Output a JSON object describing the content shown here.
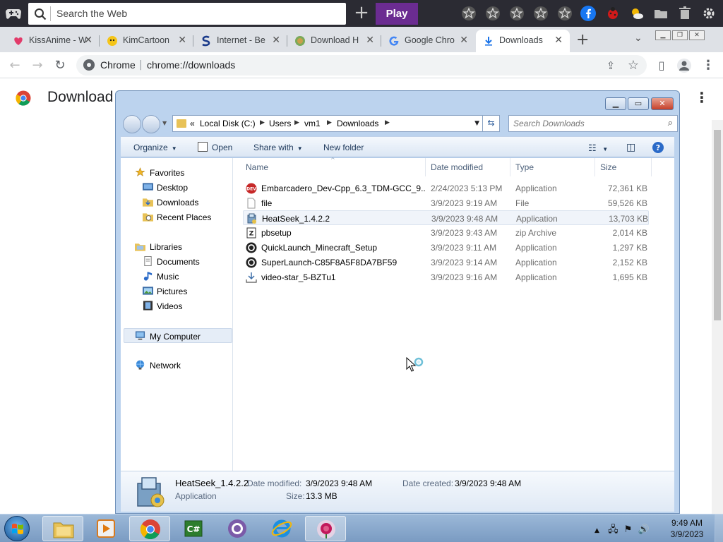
{
  "toolbar": {
    "search_placeholder": "Search the Web",
    "play_label": "Play"
  },
  "tabs": [
    {
      "title": "KissAnime - W"
    },
    {
      "title": "KimCartoon"
    },
    {
      "title": "Internet - Be"
    },
    {
      "title": "Download H"
    },
    {
      "title": "Google Chro"
    },
    {
      "title": "Downloads"
    }
  ],
  "address": {
    "site": "Chrome",
    "url": "chrome://downloads"
  },
  "page": {
    "title": "Download"
  },
  "explorer": {
    "breadcrumb": [
      "Local Disk (C:)",
      "Users",
      "vm1",
      "Downloads"
    ],
    "overflow_marker": "«",
    "search_placeholder": "Search Downloads",
    "commands": {
      "organize": "Organize",
      "open": "Open",
      "share_with": "Share with",
      "new_folder": "New folder"
    },
    "nav": {
      "favorites": "Favorites",
      "desktop": "Desktop",
      "downloads": "Downloads",
      "recent_places": "Recent Places",
      "libraries": "Libraries",
      "documents": "Documents",
      "music": "Music",
      "pictures": "Pictures",
      "videos": "Videos",
      "my_computer": "My Computer",
      "network": "Network"
    },
    "columns": {
      "name": "Name",
      "date_modified": "Date modified",
      "type": "Type",
      "size": "Size"
    },
    "files": [
      {
        "name": "Embarcadero_Dev-Cpp_6.3_TDM-GCC_9....",
        "date": "2/24/2023 5:13 PM",
        "type": "Application",
        "size": "72,361 KB"
      },
      {
        "name": "file",
        "date": "3/9/2023 9:19 AM",
        "type": "File",
        "size": "59,526 KB"
      },
      {
        "name": "HeatSeek_1.4.2.2",
        "date": "3/9/2023 9:48 AM",
        "type": "Application",
        "size": "13,703 KB"
      },
      {
        "name": "pbsetup",
        "date": "3/9/2023 9:43 AM",
        "type": "zip Archive",
        "size": "2,014 KB"
      },
      {
        "name": "QuickLaunch_Minecraft_Setup",
        "date": "3/9/2023 9:11 AM",
        "type": "Application",
        "size": "1,297 KB"
      },
      {
        "name": "SuperLaunch-C85F8A5F8DA7BF59",
        "date": "3/9/2023 9:14 AM",
        "type": "Application",
        "size": "2,152 KB"
      },
      {
        "name": "video-star_5-BZTu1",
        "date": "3/9/2023 9:16 AM",
        "type": "Application",
        "size": "1,695 KB"
      }
    ],
    "details": {
      "name": "HeatSeek_1.4.2.2",
      "type": "Application",
      "date_modified_label": "Date modified:",
      "date_modified": "3/9/2023 9:48 AM",
      "date_created_label": "Date created:",
      "date_created": "3/9/2023 9:48 AM",
      "size_label": "Size:",
      "size": "13.3 MB"
    }
  },
  "taskbar": {
    "time": "9:49 AM",
    "date": "3/9/2023"
  },
  "colors": {
    "play": "#6b2c91",
    "explorer_frame": "#bcd3ee",
    "taskbar": "#7a9bc2"
  }
}
